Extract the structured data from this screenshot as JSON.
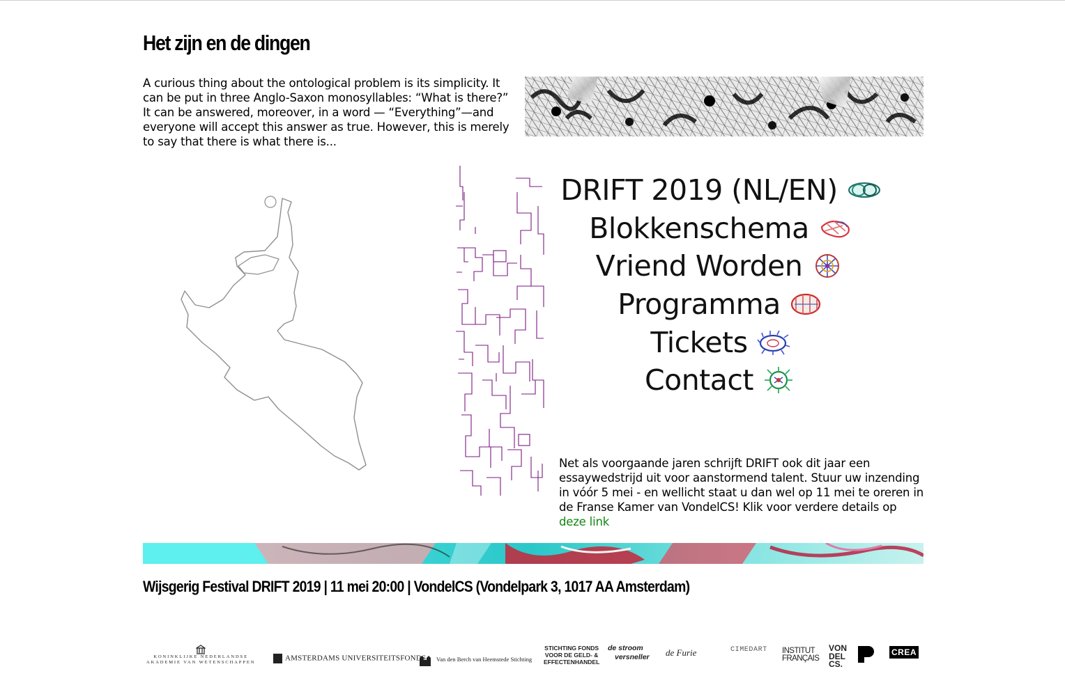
{
  "page": {
    "title": "Het zijn en de dingen",
    "intro": "A curious thing about the ontological problem is its simplicity. It can be put in three Anglo-Saxon monosyllables: “What is there?” It can be answered, moreover, in a word — “Everything”—and everyone will accept this answer as true. However, this is merely to say that there is what there is..."
  },
  "menu": {
    "items": [
      {
        "label": "DRIFT 2019 (NL/EN)",
        "icon": "wireframe-ring-icon"
      },
      {
        "label": "Blokkenschema",
        "icon": "red-wire-knot-icon"
      },
      {
        "label": "Vriend Worden",
        "icon": "multicolor-wire-sphere-icon"
      },
      {
        "label": "Programma",
        "icon": "red-wire-cylinder-icon"
      },
      {
        "label": "Tickets",
        "icon": "blue-spiky-ring-icon"
      },
      {
        "label": "Contact",
        "icon": "green-coral-icon"
      }
    ]
  },
  "blurb": {
    "text": "Net als voorgaande jaren schrijft DRIFT ook dit jaar een essaywedstrijd uit voor aanstormend talent. Stuur uw inzending in vóór 5 mei - en wellicht staat u dan wel op 11 mei te oreren in de Franse Kamer van VondelCS! Klik voor verdere details op ",
    "link": "deze link"
  },
  "footer": {
    "info": "Wijsgerig Festival DRIFT 2019 | 11 mei 20:00 | VondelCS (Vondelpark 3, 1017 AA Amsterdam)"
  },
  "sponsors": {
    "knaw_line1": "KONINKLIJKE NEDERLANDSE",
    "knaw_line2": "AKADEMIE VAN WETENSCHAPPEN",
    "auf": "AMSTERDAMS UNIVERSITEITSFONDS",
    "vdb": "Van den Berch van Heemstede Stichting",
    "sf_line1": "STICHTING FONDS",
    "sf_line2": "VOOR DE GELD- &",
    "sf_line3": "EFFECTENHANDEL",
    "ds_line1": "de stroom",
    "ds_line2": "versneller",
    "df": "de Furie",
    "cimedart": "CIMEDART",
    "if_line1": "INSTITUT",
    "if_line2": "FRANÇAIS",
    "vc_line1": "VON",
    "vc_line2": "DEL",
    "vc_line3": "CS.",
    "crea": "CREA"
  },
  "colors": {
    "link": "#118811",
    "maze": "#7a1a80",
    "outline": "#8f8f8f",
    "banner_cyan": "#5ef0ee"
  }
}
